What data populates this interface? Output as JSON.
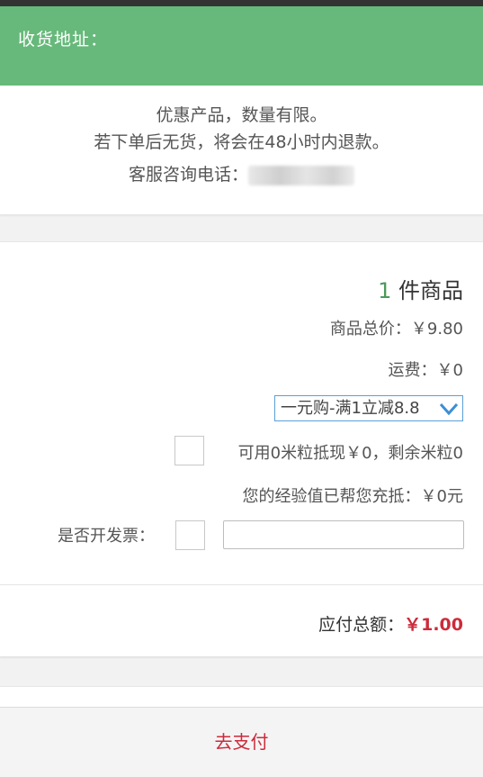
{
  "header": {
    "address_label": "收货地址："
  },
  "notice": {
    "line1": "优惠产品，数量有限。",
    "line2": "若下单后无货，将会在48小时内退款。",
    "phone_label": "客服咨询电话："
  },
  "order": {
    "item_count": "1",
    "item_unit": " 件商品",
    "total_price": "商品总价：￥9.80",
    "shipping": "运费：￥0",
    "promo_selected": "一元购-满1立减8.8",
    "points_text": "可用0米粒抵现￥0，剩余米粒0",
    "exp_text": "您的经验值已帮您充抵：￥0元",
    "invoice_label": "是否开发票：",
    "payable_label": "应付总额：",
    "payable_amount": "￥1.00"
  },
  "footer": {
    "pay_button": "去支付"
  },
  "colors": {
    "header_bg": "#66b97a",
    "accent_red": "#cc2b3b",
    "count_green": "#4c9a5a",
    "select_border": "#5aa0d8"
  },
  "icons": {
    "select_chevron": "chevron-down-icon"
  }
}
